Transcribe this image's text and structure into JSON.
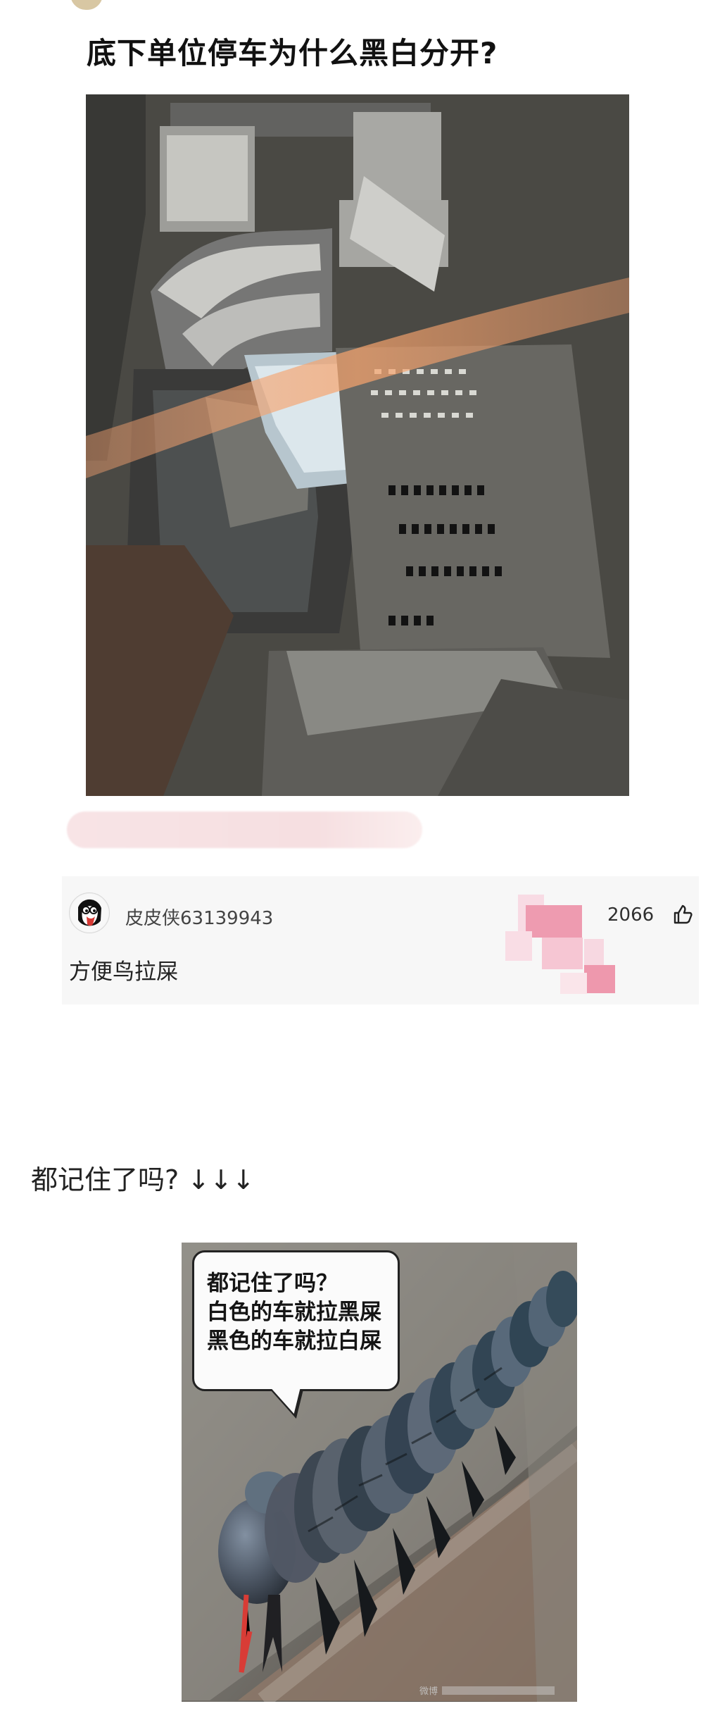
{
  "post": {
    "title": "底下单位停车为什么黑白分开?"
  },
  "comment": {
    "username": "皮皮侠63139943",
    "text": "方便鸟拉屎",
    "likes": "2066"
  },
  "follow_up": {
    "text": "都记住了吗? ↓↓↓"
  },
  "meme": {
    "bubble_lines": [
      "都记住了吗？",
      "白色的车就拉黑屎",
      "黑色的车就拉白屎"
    ],
    "watermark": "微博"
  },
  "icons": {
    "avatar": "cartoon-penguin-avatar-icon",
    "like": "thumb-up-icon"
  },
  "colors": {
    "background": "#ffffff",
    "comment_background": "#f7f7f7",
    "censor_pink": "#f3c6cf",
    "text": "#222222"
  }
}
